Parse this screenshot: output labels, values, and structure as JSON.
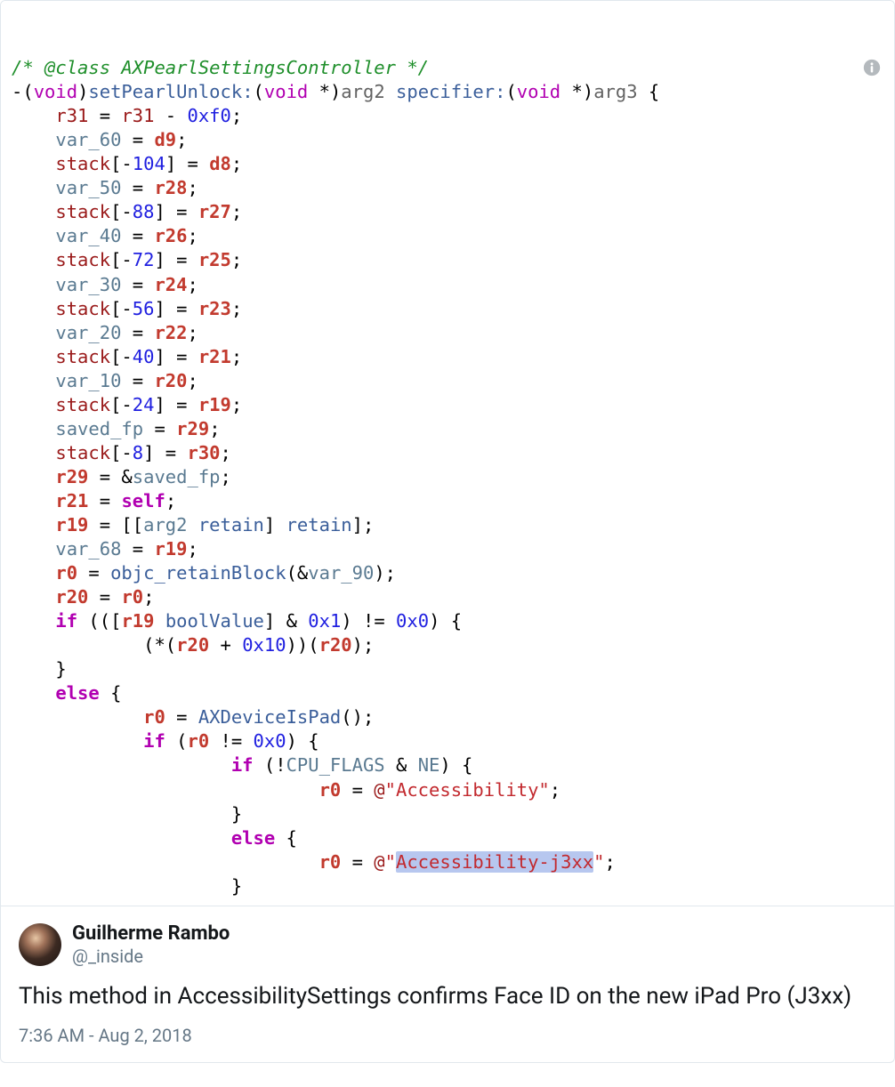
{
  "code": {
    "commentPrefix": "/* @class ",
    "className": "AXPearlSettingsController",
    "commentSuffix": " */",
    "sig_prefix": "-(",
    "sig_void1": "void",
    "sig_paren1": ")",
    "sig_method1": "setPearlUnlock:",
    "sig_lp": "(",
    "sig_void2": "void",
    "sig_star": " *",
    "sig_rp": ")",
    "sig_arg2": "arg2",
    "sig_sp": " ",
    "sig_method2": "specifier:",
    "sig_void3": "void",
    "sig_arg3": "arg3",
    "sig_brace": " {",
    "l1a": "r31",
    "l1b": " = ",
    "l1c": "r31",
    "l1d": " - ",
    "l1e": "0xf0",
    "l1f": ";",
    "l2a": "var_60",
    "l2b": " = ",
    "l2c": "d9",
    "l2d": ";",
    "l3a": "stack",
    "l3b": "[-",
    "l3c": "104",
    "l3d": "] = ",
    "l3e": "d8",
    "l3f": ";",
    "l4a": "var_50",
    "l4b": " = ",
    "l4c": "r28",
    "l4d": ";",
    "l5a": "stack",
    "l5b": "[-",
    "l5c": "88",
    "l5d": "] = ",
    "l5e": "r27",
    "l5f": ";",
    "l6a": "var_40",
    "l6b": " = ",
    "l6c": "r26",
    "l6d": ";",
    "l7a": "stack",
    "l7b": "[-",
    "l7c": "72",
    "l7d": "] = ",
    "l7e": "r25",
    "l7f": ";",
    "l8a": "var_30",
    "l8b": " = ",
    "l8c": "r24",
    "l8d": ";",
    "l9a": "stack",
    "l9b": "[-",
    "l9c": "56",
    "l9d": "] = ",
    "l9e": "r23",
    "l9f": ";",
    "l10a": "var_20",
    "l10b": " = ",
    "l10c": "r22",
    "l10d": ";",
    "l11a": "stack",
    "l11b": "[-",
    "l11c": "40",
    "l11d": "] = ",
    "l11e": "r21",
    "l11f": ";",
    "l12a": "var_10",
    "l12b": " = ",
    "l12c": "r20",
    "l12d": ";",
    "l13a": "stack",
    "l13b": "[-",
    "l13c": "24",
    "l13d": "] = ",
    "l13e": "r19",
    "l13f": ";",
    "l14a": "saved_fp",
    "l14b": " = ",
    "l14c": "r29",
    "l14d": ";",
    "l15a": "stack",
    "l15b": "[-",
    "l15c": "8",
    "l15d": "] = ",
    "l15e": "r30",
    "l15f": ";",
    "l16a": "r29",
    "l16b": " = &",
    "l16c": "saved_fp",
    "l16d": ";",
    "l17a": "r21",
    "l17b": " = ",
    "l17c": "self",
    "l17d": ";",
    "l18a": "r19",
    "l18b": " = [[",
    "l18c": "arg2",
    "l18d": " ",
    "l18e": "retain",
    "l18f": "] ",
    "l18g": "retain",
    "l18h": "];",
    "l19a": "var_68",
    "l19b": " = ",
    "l19c": "r19",
    "l19d": ";",
    "l20a": "r0",
    "l20b": " = ",
    "l20c": "objc_retainBlock",
    "l20d": "(&",
    "l20e": "var_90",
    "l20f": ");",
    "l21a": "r20",
    "l21b": " = ",
    "l21c": "r0",
    "l21d": ";",
    "l22a": "if",
    "l22b": " (([",
    "l22c": "r19",
    "l22d": " ",
    "l22e": "boolValue",
    "l22f": "] & ",
    "l22g": "0x1",
    "l22h": ") != ",
    "l22i": "0x0",
    "l22j": ") {",
    "l23a": "(*(",
    "l23b": "r20",
    "l23c": " + ",
    "l23d": "0x10",
    "l23e": "))(",
    "l23f": "r20",
    "l23g": ");",
    "l24": "}",
    "l25a": "else",
    "l25b": " {",
    "l26a": "r0",
    "l26b": " = ",
    "l26c": "AXDeviceIsPad",
    "l26d": "();",
    "l27a": "if",
    "l27b": " (",
    "l27c": "r0",
    "l27d": " != ",
    "l27e": "0x0",
    "l27f": ") {",
    "l28a": "if",
    "l28b": " (!",
    "l28c": "CPU_FLAGS",
    "l28d": " & ",
    "l28e": "NE",
    "l28f": ") {",
    "l29a": "r0",
    "l29b": " = ",
    "l29at": "@",
    "l29c": "\"Accessibility\"",
    "l29d": ";",
    "l30": "}",
    "l31a": "else",
    "l31b": " {",
    "l32a": "r0",
    "l32b": " = ",
    "l32at": "@",
    "l32q1": "\"",
    "l32c": "Accessibility-j3xx",
    "l32q2": "\"",
    "l32d": ";",
    "l33": "}"
  },
  "tweet": {
    "name": "Guilherme Rambo",
    "handle": "@_inside",
    "text": "This method in AccessibilitySettings confirms Face ID on the new iPad Pro (J3xx)",
    "time": "7:36 AM - Aug 2, 2018"
  }
}
